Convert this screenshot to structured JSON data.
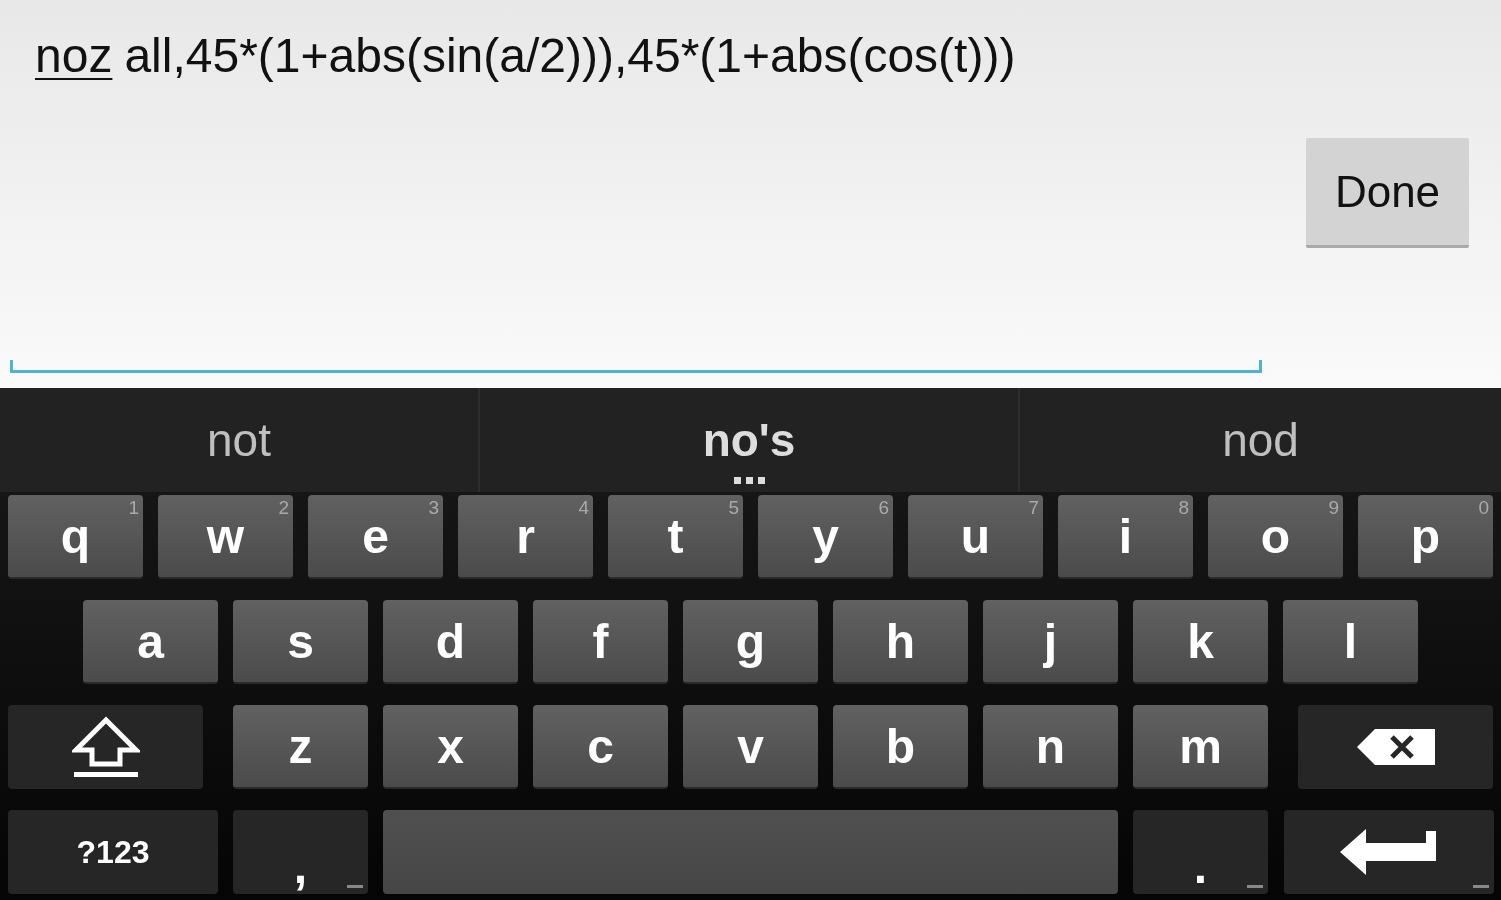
{
  "editor": {
    "composing_word": "noz",
    "text": "all,45*(1+abs(sin(a/2))),45*(1+abs(cos(t)))"
  },
  "done_button": "Done",
  "suggestions": [
    {
      "text": "not",
      "selected": false
    },
    {
      "text": "no's",
      "selected": true
    },
    {
      "text": "nod",
      "selected": false
    }
  ],
  "keyboard": {
    "rows": [
      [
        {
          "kind": "letter",
          "label": "q",
          "hint": "1"
        },
        {
          "kind": "letter",
          "label": "w",
          "hint": "2"
        },
        {
          "kind": "letter",
          "label": "e",
          "hint": "3"
        },
        {
          "kind": "letter",
          "label": "r",
          "hint": "4"
        },
        {
          "kind": "letter",
          "label": "t",
          "hint": "5"
        },
        {
          "kind": "letter",
          "label": "y",
          "hint": "6"
        },
        {
          "kind": "letter",
          "label": "u",
          "hint": "7"
        },
        {
          "kind": "letter",
          "label": "i",
          "hint": "8"
        },
        {
          "kind": "letter",
          "label": "o",
          "hint": "9"
        },
        {
          "kind": "letter",
          "label": "p",
          "hint": "0"
        }
      ],
      [
        {
          "kind": "letter",
          "label": "a"
        },
        {
          "kind": "letter",
          "label": "s"
        },
        {
          "kind": "letter",
          "label": "d"
        },
        {
          "kind": "letter",
          "label": "f"
        },
        {
          "kind": "letter",
          "label": "g"
        },
        {
          "kind": "letter",
          "label": "h"
        },
        {
          "kind": "letter",
          "label": "j"
        },
        {
          "kind": "letter",
          "label": "k"
        },
        {
          "kind": "letter",
          "label": "l"
        }
      ],
      [
        {
          "kind": "shift"
        },
        {
          "kind": "letter",
          "label": "z"
        },
        {
          "kind": "letter",
          "label": "x"
        },
        {
          "kind": "letter",
          "label": "c"
        },
        {
          "kind": "letter",
          "label": "v"
        },
        {
          "kind": "letter",
          "label": "b"
        },
        {
          "kind": "letter",
          "label": "n"
        },
        {
          "kind": "letter",
          "label": "m"
        },
        {
          "kind": "backspace"
        }
      ]
    ],
    "bottom_bar": {
      "symbols_key": "?123",
      "comma_key": ",",
      "period_key": "."
    }
  }
}
